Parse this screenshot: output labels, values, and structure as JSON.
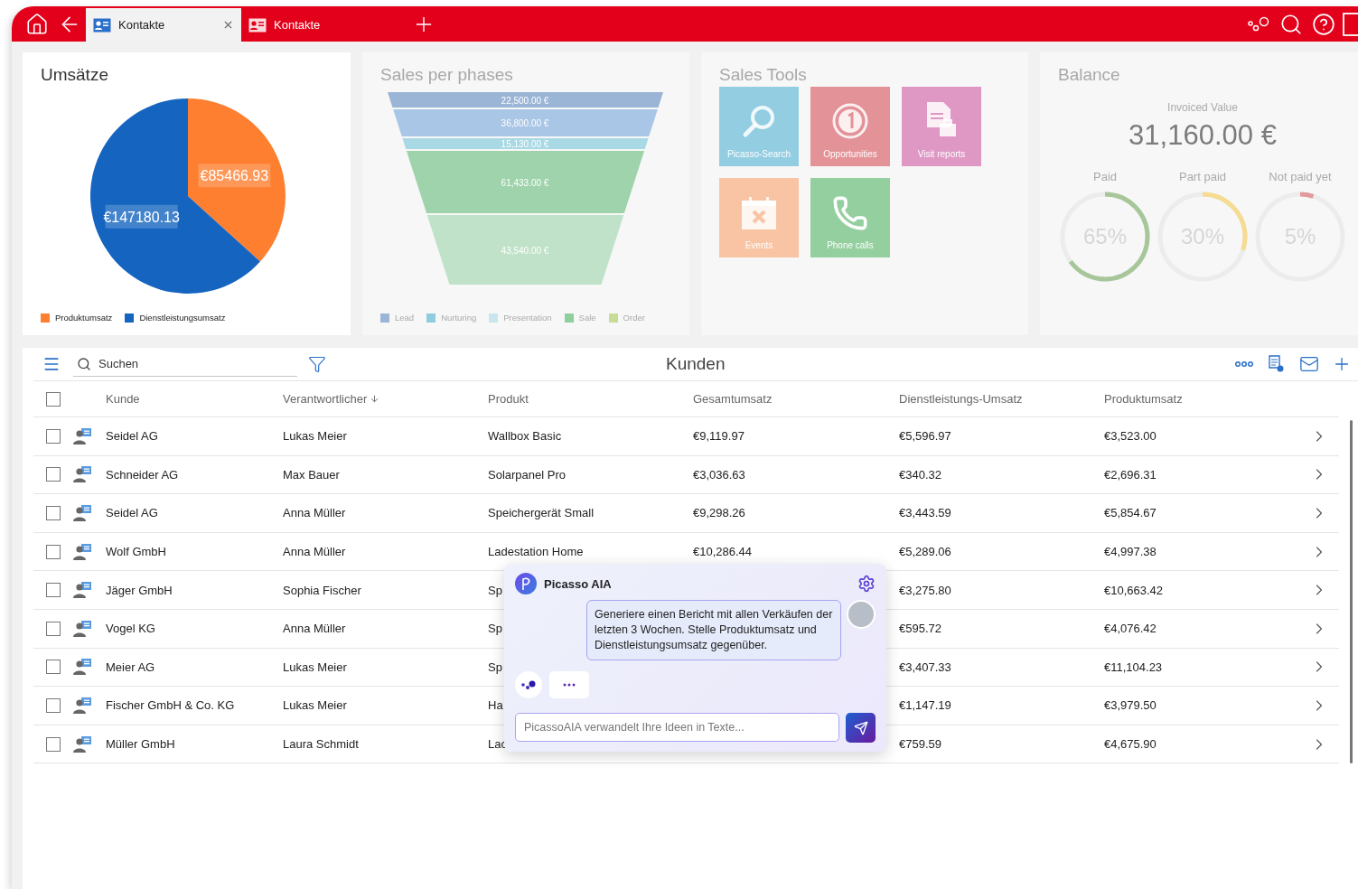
{
  "tabs": [
    {
      "label": "Kontakte",
      "selected": true
    },
    {
      "label": "Kontakte",
      "selected": false
    }
  ],
  "revenue_card": {
    "title": "Umsätze",
    "chart_data": {
      "type": "pie",
      "categories": [
        "Produktumsatz",
        "Dienstleistungsumsatz"
      ],
      "values": [
        85466.93,
        147180.13
      ],
      "value_labels": [
        "€85466.93",
        "€147180.13"
      ]
    },
    "legend": [
      {
        "color": "#fd7f2f"
      },
      {
        "color": "#1565c0"
      }
    ]
  },
  "phases_card": {
    "title": "Sales per phases",
    "stages": [
      {
        "label": "22,500.00 €",
        "color": "#9ab5d6"
      },
      {
        "label": "36,800.00 €",
        "color": "#a9c6e6"
      },
      {
        "label": "15,130.00 €",
        "color": "#a8d9e5"
      },
      {
        "label": "61,433.00 €",
        "color": "#9fd3ac"
      },
      {
        "label": "43,540.00 €",
        "color": "#bfe2c8"
      }
    ],
    "legend": [
      {
        "label": "Lead",
        "color": "#9ab5d6"
      },
      {
        "label": "Nurturing",
        "color": "#8fcce0"
      },
      {
        "label": "Presentation",
        "color": "#c9e5ee"
      },
      {
        "label": "Sale",
        "color": "#8fcf9e"
      },
      {
        "label": "Order",
        "color": "#c5dd96"
      }
    ]
  },
  "tools_card": {
    "title": "Sales Tools",
    "tiles": [
      {
        "kind": "search",
        "label": "Picasso-Search",
        "color": "#93cde1"
      },
      {
        "kind": "opportunities",
        "label": "Opportunities",
        "color": "#e39297"
      },
      {
        "kind": "reports",
        "label": "Visit reports",
        "color": "#df98c4"
      },
      {
        "kind": "events",
        "label": "Events",
        "color": "#f8c4a4"
      },
      {
        "kind": "phone",
        "label": "Phone calls",
        "color": "#94cf9f"
      }
    ]
  },
  "balance_card": {
    "title": "Balance",
    "caption": "Invoiced Value",
    "amount": "31,160.00 €",
    "gauges": [
      {
        "label": "Paid",
        "reading": "65%",
        "level": 0.65,
        "color": "#a7c79a"
      },
      {
        "label": "Part paid",
        "reading": "30%",
        "level": 0.3,
        "color": "#f5dc92"
      },
      {
        "label": "Not paid yet",
        "reading": "5%",
        "level": 0.05,
        "color": "#e29a9c"
      }
    ]
  },
  "toolbar": {
    "search_placeholder": "Suchen",
    "title": "Kunden"
  },
  "table": {
    "columns": [
      {
        "label": "Kunde",
        "sorted": false
      },
      {
        "label": "Verantwortlicher",
        "sorted": true
      },
      {
        "label": "Produkt",
        "sorted": false
      },
      {
        "label": "Gesamtumsatz",
        "sorted": false
      },
      {
        "label": "Dienstleistungs-Umsatz",
        "sorted": false
      },
      {
        "label": "Produktumsatz",
        "sorted": false
      }
    ],
    "header_checked": false,
    "rows": [
      {
        "checked": false,
        "cells": [
          "Seidel AG",
          "Lukas Meier",
          "Wallbox Basic",
          "€9,119.97",
          "€5,596.97",
          "€3,523.00"
        ]
      },
      {
        "checked": false,
        "cells": [
          "Schneider AG",
          "Max Bauer",
          "Solarpanel Pro",
          "€3,036.63",
          "€340.32",
          "€2,696.31"
        ]
      },
      {
        "checked": false,
        "cells": [
          "Seidel AG",
          "Anna Müller",
          "Speichergerät Small",
          "€9,298.26",
          "€3,443.59",
          "€5,854.67"
        ]
      },
      {
        "checked": false,
        "cells": [
          "Wolf GmbH",
          "Anna Müller",
          "Ladestation Home",
          "€10,286.44",
          "€5,289.06",
          "€4,997.38"
        ]
      },
      {
        "checked": false,
        "cells": [
          "Jäger GmbH",
          "Sophia Fischer",
          "Sp",
          null,
          "€3,275.80",
          "€10,663.42"
        ]
      },
      {
        "checked": false,
        "cells": [
          "Vogel KG",
          "Anna Müller",
          "Sp",
          null,
          "€595.72",
          "€4,076.42"
        ]
      },
      {
        "checked": false,
        "cells": [
          "Meier AG",
          "Lukas Meier",
          "Sp",
          null,
          "€3,407.33",
          "€11,104.23"
        ]
      },
      {
        "checked": false,
        "cells": [
          "Fischer GmbH & Co. KG",
          "Lukas Meier",
          "Ha",
          null,
          "€1,147.19",
          "€3,979.50"
        ]
      },
      {
        "checked": false,
        "cells": [
          "Müller GmbH",
          "Laura Schmidt",
          "Lac",
          null,
          "€759.59",
          "€4,675.90"
        ]
      }
    ]
  },
  "assistant": {
    "title": "Picasso AIA",
    "message": "Generiere einen Bericht mit allen Verkäufen der letzten 3 Wochen. Stelle Produktumsatz und Dienstleistungsumsatz gegenüber.",
    "input_placeholder": "PicassoAIA verwandelt Ihre Ideen in Texte..."
  }
}
